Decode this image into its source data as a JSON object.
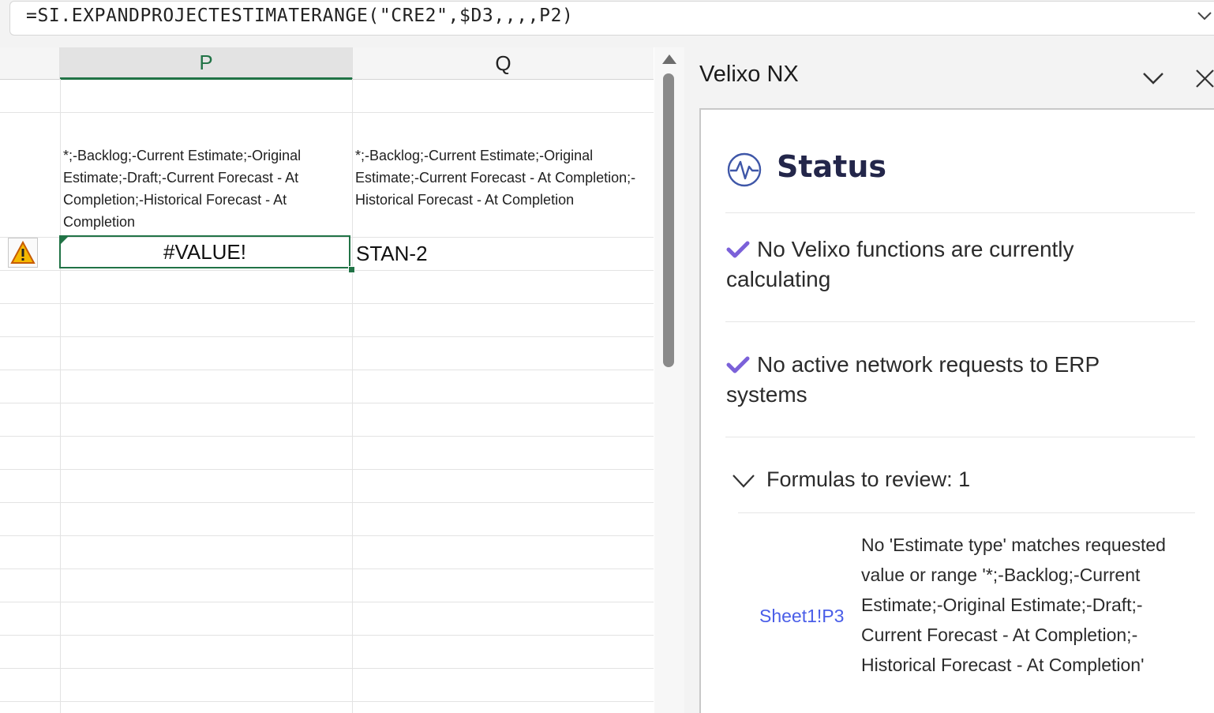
{
  "formula_bar": {
    "formula": "=SI.EXPANDPROJECTESTIMATERANGE(\"CRE2\",$D3,,,,P2)",
    "expand_icon": "chevron-down-icon"
  },
  "sheet": {
    "columns": [
      "P",
      "Q"
    ],
    "cells": {
      "P2": "*;-Backlog;-Current Estimate;-Original Estimate;-Draft;-Current Forecast - At Completion;-Historical Forecast - At Completion",
      "Q2": "*;-Backlog;-Current Estimate;-Original Estimate;-Current Forecast - At Completion;-Historical Forecast - At Completion",
      "P3": "#VALUE!",
      "Q3": "STAN-2"
    },
    "selected_cell": "P3",
    "error_indicator_icon": "warning-icon",
    "accent_color": "#217346"
  },
  "task_pane": {
    "title": "Velixo NX",
    "collapse_icon": "chevron-down-icon",
    "close_icon": "close-icon",
    "status": {
      "heading": "Status",
      "icon": "activity-pulse-icon",
      "messages": [
        "No Velixo functions are currently calculating",
        "No active network requests to ERP systems"
      ],
      "check_color": "#7b61d9"
    },
    "review": {
      "label": "Formulas to review: 1",
      "items": [
        {
          "cell_ref": "Sheet1!P3",
          "message": "No 'Estimate type' matches requested value or range '*;-Backlog;-Current Estimate;-Original Estimate;-Draft;-Current Forecast - At Completion;-Historical Forecast - At Completion'"
        }
      ]
    },
    "link_color": "#4a5ee8"
  }
}
